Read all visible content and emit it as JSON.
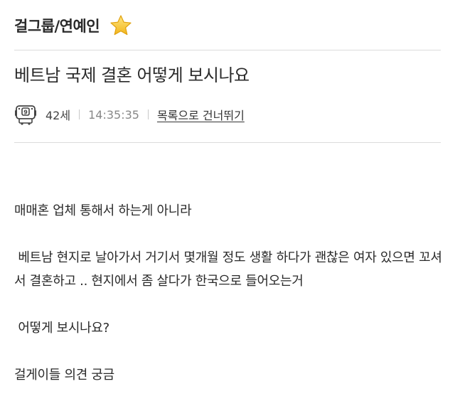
{
  "board": {
    "name": "걸그룹/연예인",
    "favorite_icon": "star-icon",
    "favorite_color": "#F5C518"
  },
  "post": {
    "title": "베트남 국제 결혼 어떻게 보시나요",
    "author": "42세",
    "avatar_icon": "robot-avatar-icon",
    "time": "14:35:35",
    "skip_link": "목록으로 건너뛰기",
    "body": [
      "매매혼 업체 통해서 하는게 아니라",
      " 베트남 현지로 날아가서 거기서 몇개월 정도 생활 하다가 괜찮은 여자 있으면 꼬셔서 결혼하고 .. 현지에서 좀 살다가 한국으로 들어오는거",
      " 어떻게 보시나요?",
      "걸게이들 의견 궁금"
    ]
  }
}
